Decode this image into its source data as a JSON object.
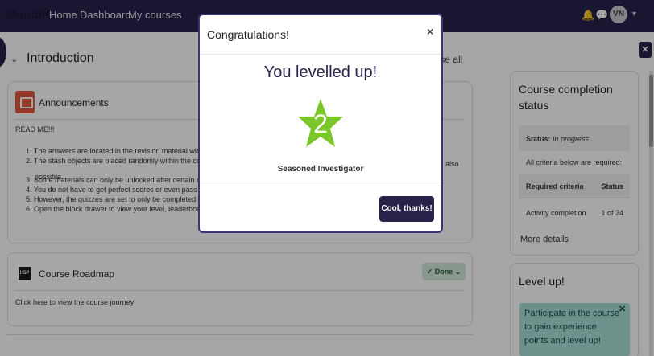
{
  "navbar": {
    "brand": "Moodle",
    "links": [
      "Home",
      "Dashboard",
      "My courses"
    ],
    "icons": [
      "bell-icon",
      "chat-icon"
    ],
    "avatar_initials": "VN"
  },
  "section": {
    "title": "Introduction",
    "collapse_all": "apse all"
  },
  "announcements": {
    "title": "Announcements",
    "readme": "READ ME!!!",
    "items": [
      "1. The answers are located in the revision material within",
      "2. The stash objects are placed randomly within the cour",
      "3. Some materials can only be unlocked after certain co",
      "4. You do not have to get perfect scores or even pass the",
      "5. However, the quizzes are set to only be completed aft",
      "6. Open the block drawer to view your level, leaderboard"
    ],
    "item2_continuation": "possible.",
    "item2_right": "also"
  },
  "roadmap": {
    "title": "Course Roadmap",
    "icon_text": "H5P",
    "done_label": "Done",
    "link_text": "Click here to view the course journey!"
  },
  "completion_block": {
    "title": "Course completion status",
    "status_label": "Status:",
    "status_value": "In progress",
    "criteria_note": "All criteria below are required:",
    "header_criteria": "Required criteria",
    "header_status": "Status",
    "activity_label": "Activity completion",
    "activity_status": "1 of 24",
    "more_details": "More details"
  },
  "levelup_block": {
    "title": "Level up!",
    "alert_text": "Participate in the course to gain experience points and level up!"
  },
  "modal": {
    "title": "Congratulations!",
    "heading": "You levelled up!",
    "level": "2",
    "badge_name": "Seasoned Investigator",
    "button_label": "Cool, thanks!",
    "star_color": "#7bc628"
  },
  "colors": {
    "navbar": "#26224a",
    "primary_button": "#26224a",
    "alert_bg": "#a9dfd7"
  }
}
